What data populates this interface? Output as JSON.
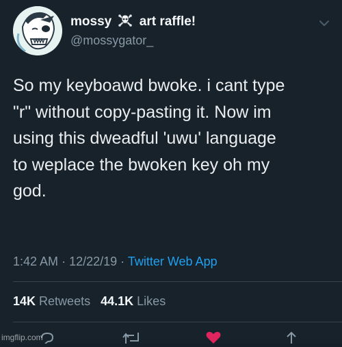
{
  "tweet": {
    "display_name_part1": "mossy",
    "display_name_part2": "art raffle!",
    "display_name_emoji": "skull-and-crossbones-icon",
    "handle": "@mossygator_",
    "body_lines": [
      "So my keyboawd bwoke. i cant type",
      "\"r\" without copy-pasting it. Now im",
      "using this dweadful 'uwu' language",
      "to weplace the bwoken key oh my",
      "god."
    ],
    "time": "1:42 AM",
    "date": "12/22/19",
    "separator": "·",
    "source": "Twitter Web App",
    "retweets_count": "14K",
    "retweets_label": "Retweets",
    "likes_count": "44.1K",
    "likes_label": "Likes"
  },
  "icons": [
    "chevron-down-icon",
    "reply-icon",
    "retweet-icon",
    "like-icon",
    "share-icon"
  ],
  "watermark": "imgflip.com",
  "colors": {
    "background": "#18222b",
    "primary_text": "#ebeef0",
    "secondary_text": "#8899a6",
    "link": "#1da1f2",
    "like": "#e0245e",
    "divider": "#38444d"
  }
}
